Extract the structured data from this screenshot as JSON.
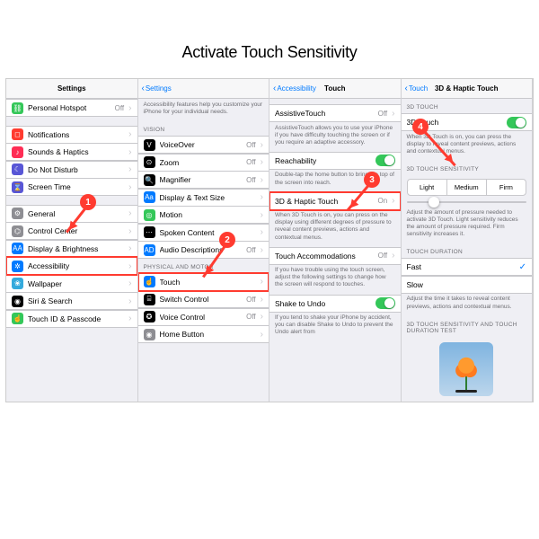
{
  "heading": "Activate Touch Sensitivity",
  "panel1": {
    "title": "Settings",
    "items": [
      {
        "icon_bg": "#34c759",
        "glyph": "⛓",
        "label": "Personal Hotspot",
        "value": "Off"
      },
      {
        "icon_bg": "#ff3b30",
        "glyph": "◻",
        "label": "Notifications"
      },
      {
        "icon_bg": "#ff2d55",
        "glyph": "♪",
        "label": "Sounds & Haptics"
      },
      {
        "icon_bg": "#5856d6",
        "glyph": "☾",
        "label": "Do Not Disturb"
      },
      {
        "icon_bg": "#5856d6",
        "glyph": "⌛",
        "label": "Screen Time"
      },
      {
        "icon_bg": "#8e8e93",
        "glyph": "⚙",
        "label": "General"
      },
      {
        "icon_bg": "#8e8e93",
        "glyph": "⌬",
        "label": "Control Center"
      },
      {
        "icon_bg": "#007aff",
        "glyph": "AA",
        "label": "Display & Brightness"
      },
      {
        "icon_bg": "#007aff",
        "glyph": "✲",
        "label": "Accessibility",
        "highlight": true
      },
      {
        "icon_bg": "#34aadc",
        "glyph": "❀",
        "label": "Wallpaper"
      },
      {
        "icon_bg": "#000000",
        "glyph": "◉",
        "label": "Siri & Search"
      },
      {
        "icon_bg": "#34c759",
        "glyph": "☝",
        "label": "Touch ID & Passcode"
      }
    ]
  },
  "panel2": {
    "back": "Settings",
    "intro": "Accessibility features help you customize your iPhone for your individual needs.",
    "section_vision": "VISION",
    "vision_items": [
      {
        "icon_bg": "#000000",
        "glyph": "V",
        "label": "VoiceOver",
        "value": "Off"
      },
      {
        "icon_bg": "#000000",
        "glyph": "⊙",
        "label": "Zoom",
        "value": "Off"
      },
      {
        "icon_bg": "#000000",
        "glyph": "🔍",
        "label": "Magnifier",
        "value": "Off"
      },
      {
        "icon_bg": "#007aff",
        "glyph": "Aa",
        "label": "Display & Text Size"
      },
      {
        "icon_bg": "#34c759",
        "glyph": "◎",
        "label": "Motion"
      },
      {
        "icon_bg": "#000000",
        "glyph": "⋯",
        "label": "Spoken Content"
      },
      {
        "icon_bg": "#007aff",
        "glyph": "AD",
        "label": "Audio Descriptions",
        "value": "Off"
      }
    ],
    "section_motor": "PHYSICAL AND MOTOR",
    "motor_items": [
      {
        "icon_bg": "#007aff",
        "glyph": "☝",
        "label": "Touch",
        "highlight": true
      },
      {
        "icon_bg": "#000000",
        "glyph": "⌸",
        "label": "Switch Control",
        "value": "Off"
      },
      {
        "icon_bg": "#000000",
        "glyph": "✪",
        "label": "Voice Control",
        "value": "Off"
      },
      {
        "icon_bg": "#8e8e93",
        "glyph": "◉",
        "label": "Home Button"
      }
    ]
  },
  "panel3": {
    "back": "Accessibility",
    "title": "Touch",
    "assistive": {
      "label": "AssistiveTouch",
      "value": "Off"
    },
    "assistive_footer": "AssistiveTouch allows you to use your iPhone if you have difficulty touching the screen or if you require an adaptive accessory.",
    "reachability": {
      "label": "Reachability"
    },
    "reachability_footer": "Double-tap the home button to bring the top of the screen into reach.",
    "haptic": {
      "label": "3D & Haptic Touch",
      "value": "On"
    },
    "haptic_footer": "When 3D Touch is on, you can press on the display using different degrees of pressure to reveal content previews, actions and contextual menus.",
    "accom": {
      "label": "Touch Accommodations",
      "value": "Off"
    },
    "accom_footer": "If you have trouble using the touch screen, adjust the following settings to change how the screen will respond to touches.",
    "shake": {
      "label": "Shake to Undo"
    },
    "shake_footer": "If you tend to shake your iPhone by accident, you can disable Shake to Undo to prevent the Undo alert from"
  },
  "panel4": {
    "back": "Touch",
    "title": "3D & Haptic Touch",
    "section_toggle": "3D TOUCH",
    "toggle": {
      "label": "3D Touch"
    },
    "toggle_footer": "When 3D Touch is on, you can press the display to reveal content previews, actions and contextual menus.",
    "section_sensitivity": "3D TOUCH SENSITIVITY",
    "seg": {
      "light": "Light",
      "medium": "Medium",
      "firm": "Firm"
    },
    "sensitivity_footer": "Adjust the amount of pressure needed to activate 3D Touch. Light sensitivity reduces the amount of pressure required. Firm sensitivity increases it.",
    "section_duration": "TOUCH DURATION",
    "duration": {
      "fast": "Fast",
      "slow": "Slow"
    },
    "duration_footer": "Adjust the time it takes to reveal content previews, actions and contextual menus.",
    "section_test": "3D TOUCH SENSITIVITY AND TOUCH DURATION TEST"
  },
  "steps": {
    "s1": "1",
    "s2": "2",
    "s3": "3",
    "s4": "4"
  }
}
